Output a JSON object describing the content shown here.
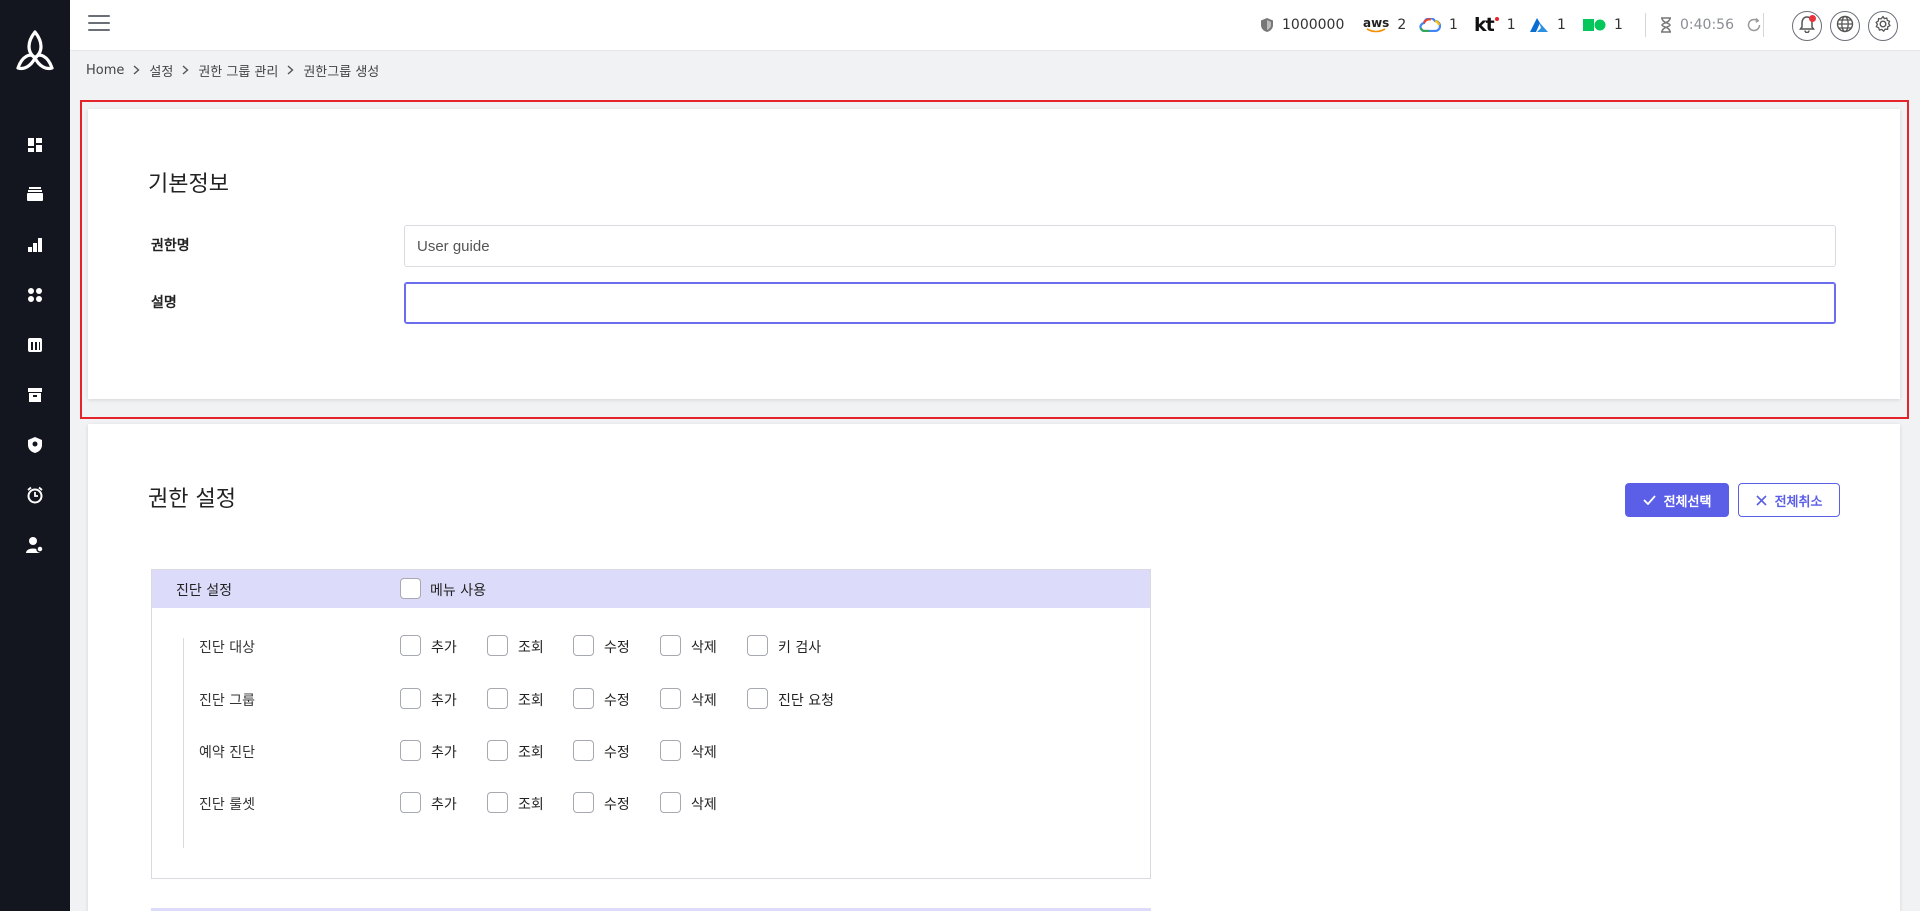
{
  "colors": {
    "accent": "#5b5fe8",
    "sidebar_bg": "#13151f",
    "highlight": "#e5232b",
    "table_header": "#dcdcfa"
  },
  "topbar": {
    "shield_count": "1000000",
    "aws": {
      "label": "aws",
      "count": "2"
    },
    "gcp_count": "1",
    "kt": {
      "label": "kt",
      "count": "1"
    },
    "azure_count": "1",
    "ncloud_count": "1",
    "timer": "0:40:56"
  },
  "breadcrumb": [
    "Home",
    "설정",
    "권한 그룹 관리",
    "권한그룹 생성"
  ],
  "basic_info": {
    "title": "기본정보",
    "name_label": "권한명",
    "name_value": "User guide",
    "desc_label": "설명",
    "desc_value": ""
  },
  "permission": {
    "title": "권한 설정",
    "select_all": "전체선택",
    "cancel_all": "전체취소",
    "group": {
      "name": "진단 설정",
      "menu_use": "메뉴 사용",
      "rows": [
        {
          "label": "진단 대상",
          "actions": [
            "추가",
            "조회",
            "수정",
            "삭제",
            "키 검사"
          ]
        },
        {
          "label": "진단 그룹",
          "actions": [
            "추가",
            "조회",
            "수정",
            "삭제",
            "진단 요청"
          ]
        },
        {
          "label": "예약 진단",
          "actions": [
            "추가",
            "조회",
            "수정",
            "삭제"
          ]
        },
        {
          "label": "진단 룰셋",
          "actions": [
            "추가",
            "조회",
            "수정",
            "삭제"
          ]
        }
      ]
    }
  }
}
